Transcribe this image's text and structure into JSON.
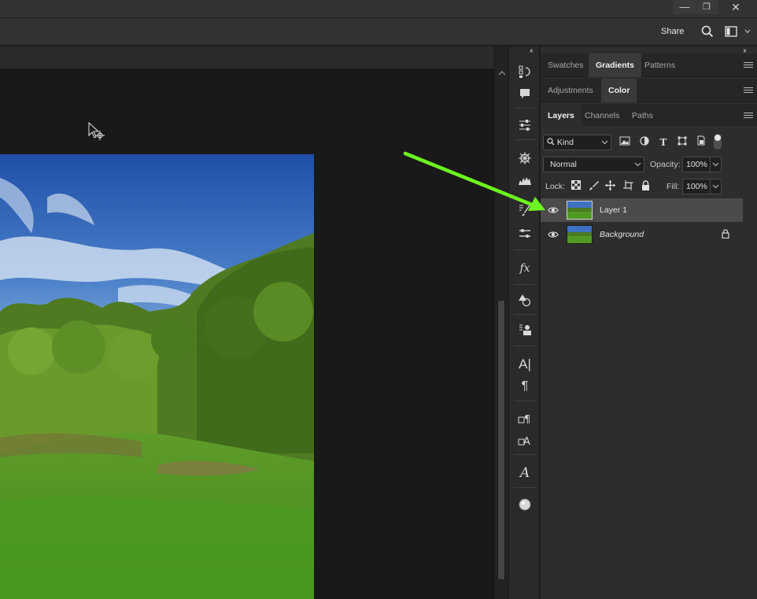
{
  "window": {
    "minimize_glyph": "—",
    "restore_glyph": "❐",
    "close_glyph": "✕"
  },
  "optionsbar": {
    "share_label": "Share"
  },
  "panels": {
    "row1_tabs": [
      "Swatches",
      "Gradients",
      "Patterns"
    ],
    "row1_active": "Gradients",
    "row2_tabs": [
      "Adjustments",
      "Color"
    ],
    "row2_active": "Color",
    "row3_tabs": [
      "Layers",
      "Channels",
      "Paths"
    ],
    "row3_active": "Layers"
  },
  "layers_panel": {
    "filter_kind": "Kind",
    "blend_mode": "Normal",
    "opacity_label": "Opacity:",
    "opacity_value": "100%",
    "lock_label": "Lock:",
    "fill_label": "Fill:",
    "fill_value": "100%",
    "layers": [
      {
        "name": "Layer 1",
        "selected": true,
        "visible": true,
        "locked": false
      },
      {
        "name": "Background",
        "selected": false,
        "visible": true,
        "locked": true
      }
    ]
  },
  "annotation": {
    "arrow_color": "#6cf51e"
  },
  "colors": {
    "panel_bg": "#2d2d2d",
    "pasteboard": "#191919",
    "selected_layer": "#4b4b4b"
  }
}
